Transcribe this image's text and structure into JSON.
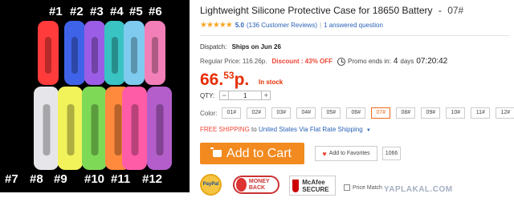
{
  "product_image": {
    "top_labels": [
      "#1",
      "#2",
      "#3",
      "#4",
      "#5",
      "#6"
    ],
    "bottom_labels": [
      "#7",
      "#8",
      "#9",
      "#10",
      "#11",
      "#12"
    ],
    "top_colors": [
      "#ff3b3b",
      "#3f63e8",
      "#9b5de5",
      "#39c3c3",
      "#7ecbef",
      "#f27fb8"
    ],
    "bottom_colors": [
      "#e6e6ea",
      "#f2f25a",
      "#7ed957",
      "#ff8a3d",
      "#ff5ca8",
      "#b35ecb"
    ]
  },
  "title": {
    "text": "Lightweight Silicone Protective Case for 18650 Battery",
    "sep": "-",
    "sku": "07#"
  },
  "rating": {
    "stars": "★★★★★",
    "value": "5.0",
    "reviews": "(136 Customer Reviews)",
    "sep": "|",
    "questions": "1 answered question"
  },
  "dispatch": {
    "label": "Dispatch:",
    "value": "Ships on Jun 26"
  },
  "pricing": {
    "regular": "Regular Price: 116.26р.",
    "discount": "Discount : 43% OFF",
    "promo": "Promo ends in:",
    "days": "4",
    "days_label": "days",
    "countdown": "07:20:42",
    "price_main": "66.",
    "price_cents": "53",
    "price_currency": "р.",
    "stock": "In stock"
  },
  "qty": {
    "label": "QTY:",
    "minus": "−",
    "value": "1",
    "plus": "+"
  },
  "color": {
    "label": "Color:",
    "options": [
      "01#",
      "02#",
      "03#",
      "04#",
      "05#",
      "06#",
      "07#",
      "08#",
      "09#",
      "10#",
      "11#",
      "12#"
    ],
    "selected_index": 6,
    "selected_color": "#f06a1c"
  },
  "shipping": {
    "free": "FREE SHIPPING",
    "to": "to",
    "destination": "United States Via Flat Rate Shipping",
    "caret": "▼"
  },
  "actions": {
    "add_to_cart": "Add to Cart",
    "add_to_favorites": "Add to Favorites",
    "favorites_count": "1066",
    "cart_color": "#f28a1f"
  },
  "badges": {
    "paypal": "PayPal",
    "money_back": "MONEY BACK",
    "mcafee": "McAfee SECURE",
    "price_match": "Price Match"
  },
  "watermark": "YAPLAKAL.COM"
}
